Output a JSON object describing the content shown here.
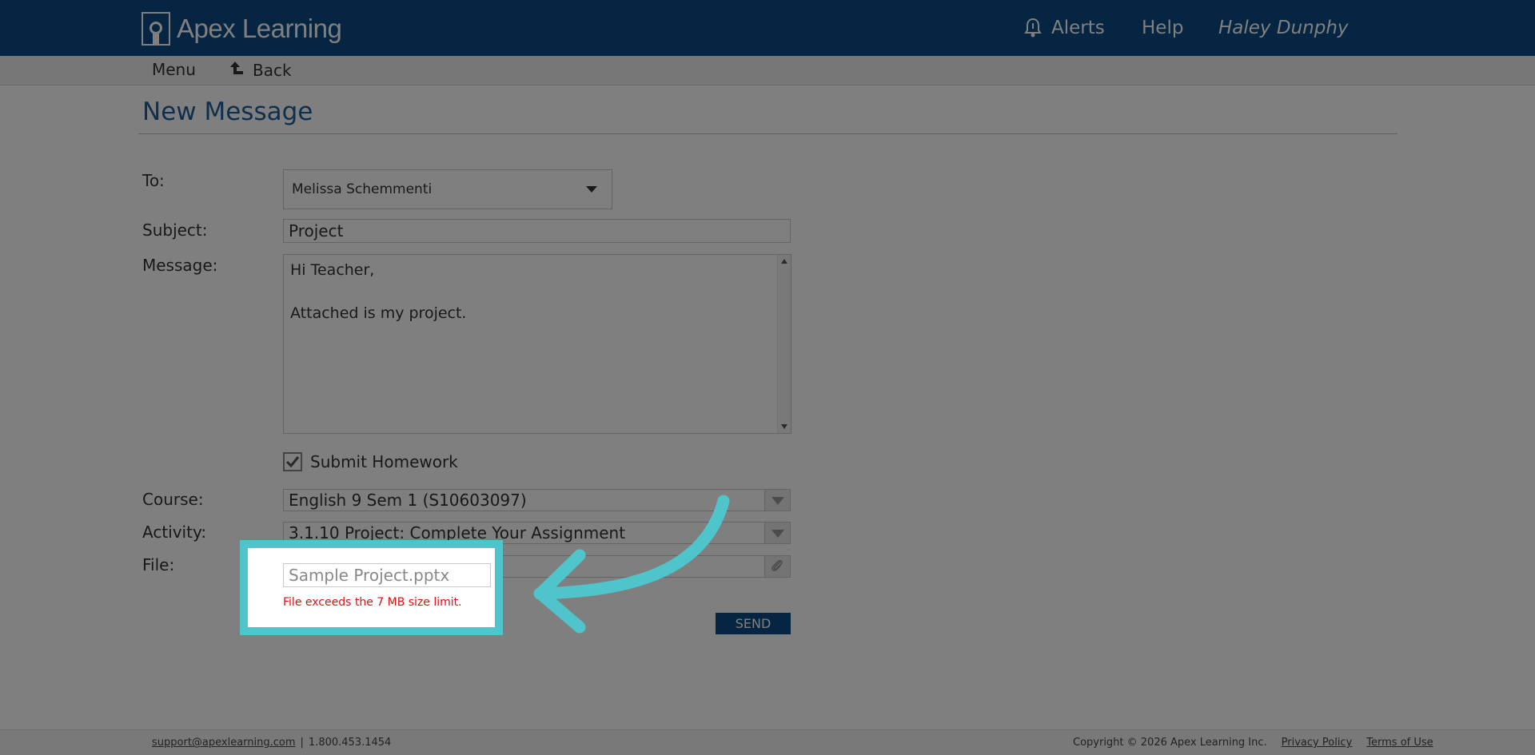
{
  "header": {
    "logo_text": "Apex Learning",
    "alerts_label": "Alerts",
    "help_label": "Help",
    "user_name": "Haley Dunphy"
  },
  "subnav": {
    "menu_label": "Menu",
    "back_label": "Back"
  },
  "page": {
    "title": "New Message"
  },
  "form": {
    "to_label": "To:",
    "to_value": "Melissa Schemmenti",
    "subject_label": "Subject:",
    "subject_value": "Project",
    "message_label": "Message:",
    "message_lines": [
      "Hi Teacher,",
      "",
      "Attached is my project."
    ],
    "submit_homework_label": "Submit Homework",
    "submit_homework_checked": true,
    "course_label": "Course:",
    "course_value": "English 9 Sem 1 (S10603097)",
    "activity_label": "Activity:",
    "activity_value": "3.1.10 Project: Complete Your Assignment",
    "file_label": "File:",
    "file_value": "Sample Project.pptx",
    "error_message": "File exceeds the 7 MB size limit.",
    "send_label": "SEND"
  },
  "footer": {
    "support_email": "support@apexlearning.com",
    "separator": "|",
    "phone": "1.800.453.1454",
    "copyright": "Copyright © 2026 Apex Learning Inc.",
    "privacy_label": "Privacy Policy",
    "terms_label": "Terms of Use"
  },
  "colors": {
    "header_bg": "#0b4a86",
    "title_blue": "#1f5f9d",
    "error_red": "#e01010",
    "highlight_teal": "#4fc4cb",
    "overlay": "rgba(0,0,0,0.5)"
  },
  "icons": [
    "apex-logo-icon",
    "bell-icon",
    "back-arrow-icon",
    "chevron-down-icon",
    "checkmark-icon",
    "paperclip-icon",
    "callout-arrow"
  ]
}
